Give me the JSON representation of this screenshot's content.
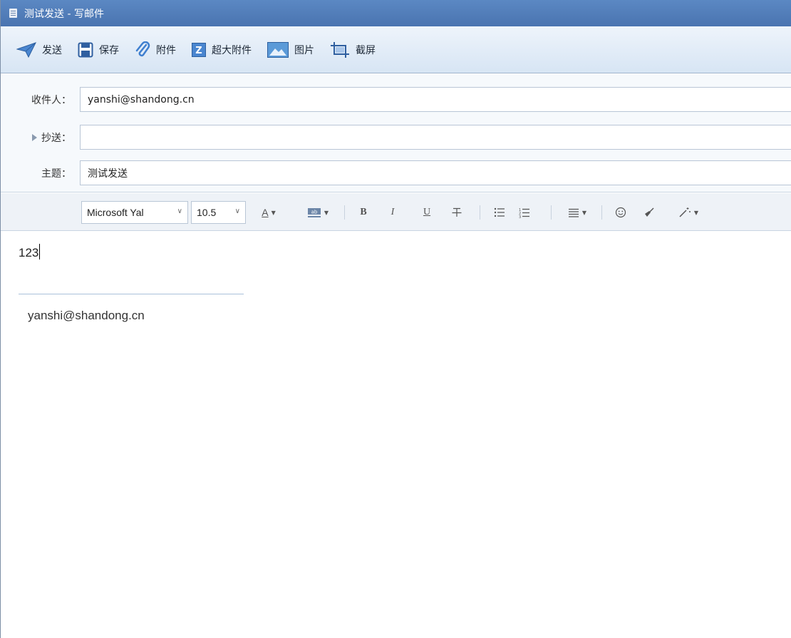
{
  "window": {
    "title": "测试发送 - 写邮件"
  },
  "toolbar": {
    "send": "发送",
    "save": "保存",
    "attach": "附件",
    "large_attach": "超大附件",
    "picture": "图片",
    "screenshot": "截屏"
  },
  "fields": {
    "to_label": "收件人：",
    "to_value": "yanshi@shandong.cn",
    "cc_label": "抄送：",
    "cc_value": "",
    "subject_label": "主题：",
    "subject_value": "测试发送"
  },
  "format": {
    "font_family": "Microsoft Yal",
    "font_size": "10.5"
  },
  "body": {
    "text": "123",
    "signature": "yanshi@shandong.cn"
  },
  "colors": {
    "titlebar": "#4f7cb8",
    "toolbar": "#dbe7f5",
    "send_icon": "#3f78c8"
  }
}
